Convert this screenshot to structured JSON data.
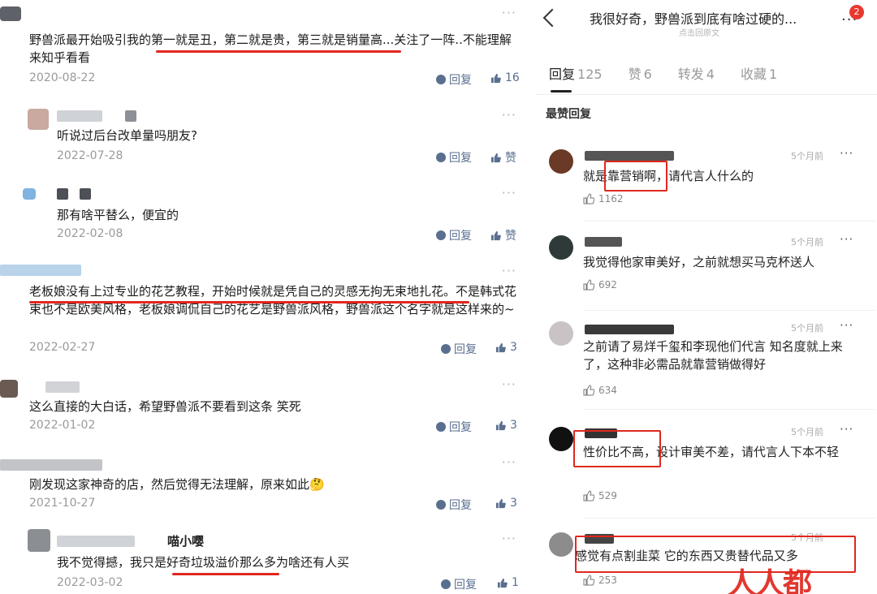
{
  "left": {
    "comments": [
      {
        "text": "野兽派最开始吸引我的第一就是丑，第二就是贵，第三就是销量高...关注了一阵..不能理解来知乎看看",
        "date": "2020-08-22",
        "reply": "回复",
        "likes": "16"
      },
      {
        "text": "听说过后台改单量吗朋友?",
        "date": "2022-07-28",
        "reply": "回复",
        "likes": "赞"
      },
      {
        "text": "那有啥平替么，便宜的",
        "date": "2022-02-08",
        "reply": "回复",
        "likes": "赞"
      },
      {
        "text": "老板娘没有上过专业的花艺教程，开始时候就是凭自己的灵感无拘无束地扎花。不是韩式花束也不是欧美风格，老板娘调侃自己的花艺是野兽派风格，野兽派这个名字就是这样来的~",
        "date": "2022-02-27",
        "reply": "回复",
        "likes": "3"
      },
      {
        "text": "这么直接的大白话，希望野兽派不要看到这条 笑死",
        "date": "2022-01-02",
        "reply": "回复",
        "likes": "3"
      },
      {
        "text": "刚发现这家神奇的店，然后觉得无法理解，原来如此🤔",
        "date": "2021-10-27",
        "reply": "回复",
        "likes": "3"
      },
      {
        "name": "喵小嘤",
        "text": "我不觉得撼，我只是好奇垃圾溢价那么多为啥还有人买",
        "date": "2022-03-02",
        "reply": "回复",
        "likes": "1"
      }
    ],
    "more": "···"
  },
  "right": {
    "title": "我很好奇，野兽派到底有啥过硬的...",
    "subtitle": "点击回原文",
    "more": "···",
    "badge": "2",
    "tabs": [
      {
        "label": "回复",
        "count": "125"
      },
      {
        "label": "赞",
        "count": "6"
      },
      {
        "label": "转发",
        "count": "4"
      },
      {
        "label": "收藏",
        "count": "1"
      }
    ],
    "section": "最赞回复",
    "comments": [
      {
        "time": "5个月前",
        "text": "就是靠营销啊，请代言人什么的",
        "likes": "1162"
      },
      {
        "time": "5个月前",
        "text": "我觉得他家审美好，之前就想买马克杯送人",
        "likes": "692"
      },
      {
        "time": "5个月前",
        "text": "之前请了易烊千玺和李现他们代言 知名度就上来了，这种非必需品就靠营销做得好",
        "likes": "634"
      },
      {
        "time": "5个月前",
        "text": "性价比不高，设计审美不差，请代言人下本不轻",
        "likes": "529"
      },
      {
        "time": "5个月前",
        "text": "感觉有点割韭菜 它的东西又贵替代品又多",
        "likes": "253"
      }
    ],
    "watermark": "人人都"
  },
  "colors": {
    "accent_red": "#e0271f",
    "link_blue": "#5a6f8f"
  },
  "icons": [
    "back-arrow-icon",
    "comment-bubble-icon",
    "thumb-up-icon",
    "more-dots-icon"
  ]
}
